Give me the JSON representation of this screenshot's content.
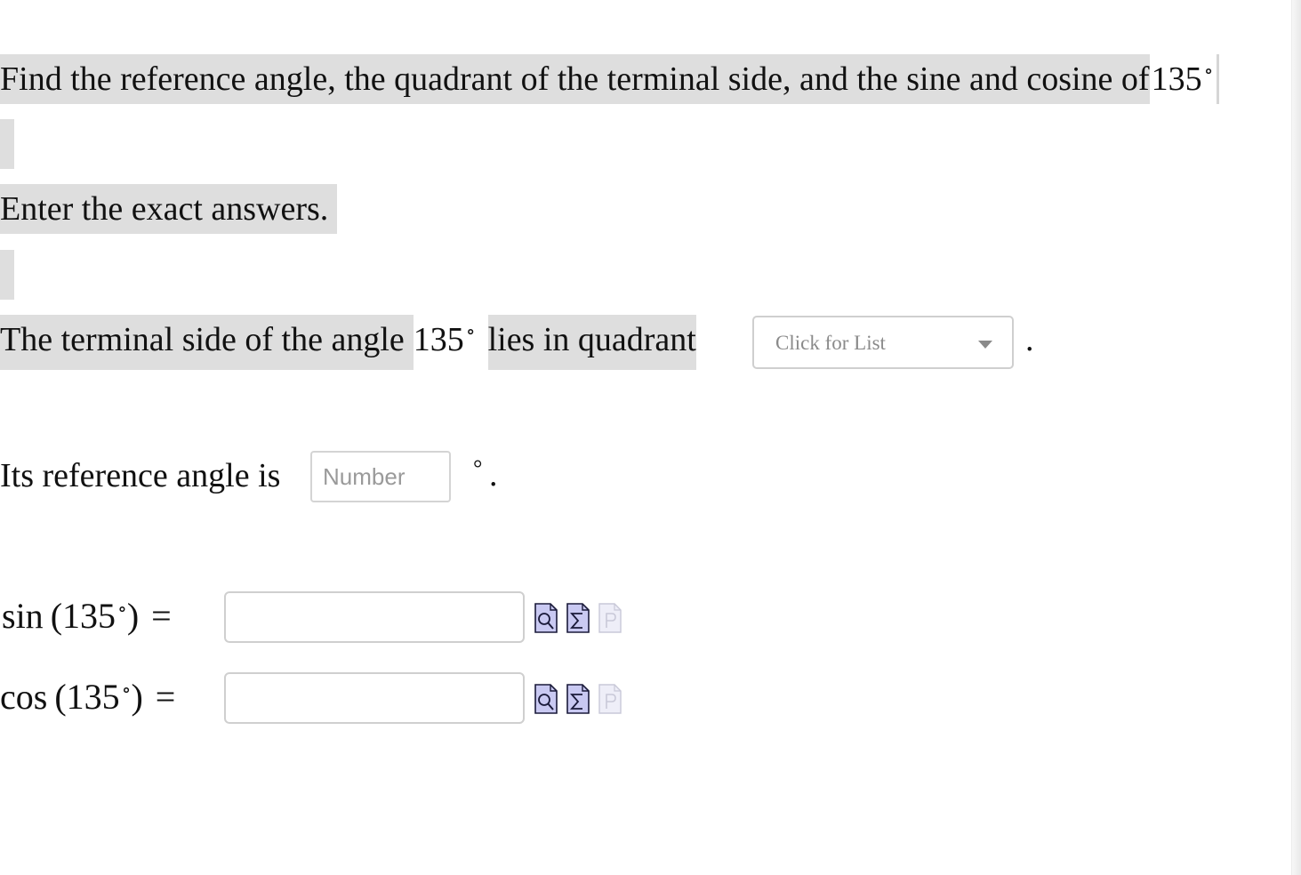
{
  "question": {
    "text": "Find the reference angle, the quadrant of the terminal side, and the sine and cosine of",
    "angle": "135",
    "degree_symbol": "∘"
  },
  "instruction": "Enter the exact answers.",
  "terminal": {
    "prefix": "The terminal side of the angle",
    "angle": "135",
    "suffix": "lies in quadrant",
    "select_label": "Click for List",
    "period": "."
  },
  "reference": {
    "prefix": "Its reference angle is",
    "placeholder": "Number",
    "degree": "°",
    "period": "."
  },
  "sin": {
    "func": "sin",
    "angle": "135",
    "equals": "="
  },
  "cos": {
    "func": "cos",
    "angle": "135",
    "equals": "="
  },
  "icons": {
    "preview": "preview-icon",
    "equation_editor": "equation-editor-icon",
    "hint": "hint-icon"
  }
}
